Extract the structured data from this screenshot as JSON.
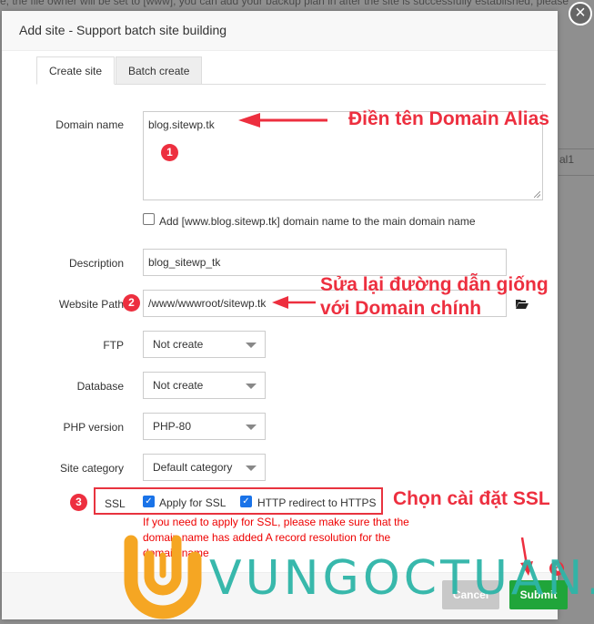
{
  "background": {
    "top_text": "e; the file owner will be set to [www], you can add your backup plan in after the site is successfully established, please",
    "right_cell": "al1"
  },
  "dialog": {
    "title": "Add site - Support batch site building",
    "close_icon": "close-icon",
    "tabs": [
      {
        "label": "Create site",
        "active": true
      },
      {
        "label": "Batch create",
        "active": false
      }
    ],
    "form": {
      "domain": {
        "label": "Domain name",
        "value": "blog.sitewp.tk"
      },
      "add_www": {
        "checked": false,
        "label": "Add [www.blog.sitewp.tk] domain name to the main domain name"
      },
      "description": {
        "label": "Description",
        "value": "blog_sitewp_tk"
      },
      "path": {
        "label": "Website Path",
        "value": "/www/wwwroot/sitewp.tk",
        "icon": "folder-open-icon"
      },
      "ftp": {
        "label": "FTP",
        "value": "Not create"
      },
      "database": {
        "label": "Database",
        "value": "Not create"
      },
      "php": {
        "label": "PHP version",
        "value": "PHP-80"
      },
      "category": {
        "label": "Site category",
        "value": "Default category"
      },
      "ssl": {
        "label": "SSL",
        "apply": {
          "label": "Apply for SSL",
          "checked": true
        },
        "redirect": {
          "label": "HTTP redirect to HTTPS",
          "checked": true
        },
        "note": "If you need to apply for SSL, please make sure that the domain name has added A record resolution for the domain name"
      }
    },
    "footer": {
      "cancel": "Cancel",
      "submit": "Submit"
    }
  },
  "annotations": {
    "note1": "Điền tên Domain Alias",
    "note2_line1": "Sửa lại đường dẫn giống",
    "note2_line2": "với Domain chính",
    "note3": "Chọn cài đặt SSL",
    "badges": [
      "1",
      "2",
      "3",
      "4"
    ],
    "color": "#ed2f3f"
  },
  "watermark": {
    "text": "VUNGOCTUAN.VN",
    "colors": {
      "logo": "#f5a623",
      "text": "#2eb5a8"
    }
  }
}
